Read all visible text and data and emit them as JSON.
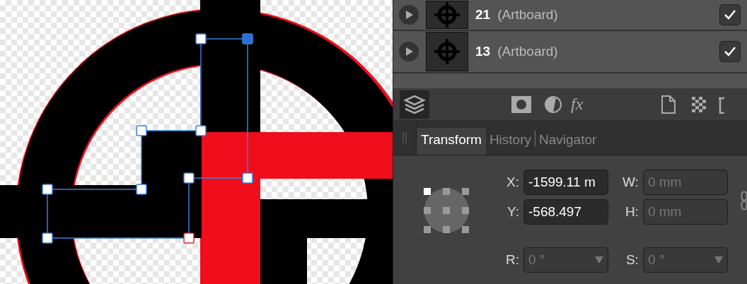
{
  "layers": [
    {
      "name": "21",
      "type": "(Artboard)",
      "checked": true,
      "expanded": false
    },
    {
      "name": "13",
      "type": "(Artboard)",
      "checked": true,
      "expanded": false
    }
  ],
  "toolbar": {
    "fx_label": "fx",
    "layers_selected": true
  },
  "tabs": [
    {
      "label": "Transform",
      "selected": true
    },
    {
      "label": "History",
      "selected": false
    },
    {
      "label": "Navigator",
      "selected": false
    }
  ],
  "transform": {
    "anchors": [
      {
        "selected": true
      },
      {
        "selected": false
      },
      {
        "selected": false
      },
      {
        "selected": false
      },
      {
        "selected": false
      },
      {
        "selected": false
      },
      {
        "selected": false
      },
      {
        "selected": false
      },
      {
        "selected": false
      }
    ],
    "fields": [
      {
        "label": "X:",
        "value": "-1599.11 m",
        "disabled": false,
        "kind": "text"
      },
      {
        "label": "W:",
        "value": "0 mm",
        "disabled": true,
        "kind": "text"
      },
      {
        "label": "Y:",
        "value": "-568.497",
        "disabled": false,
        "kind": "text"
      },
      {
        "label": "H:",
        "value": "0 mm",
        "disabled": true,
        "kind": "text"
      },
      {
        "label": "R:",
        "value": "0 °",
        "disabled": true,
        "kind": "dropdown"
      },
      {
        "label": "S:",
        "value": "0 °",
        "disabled": true,
        "kind": "dropdown"
      }
    ]
  }
}
